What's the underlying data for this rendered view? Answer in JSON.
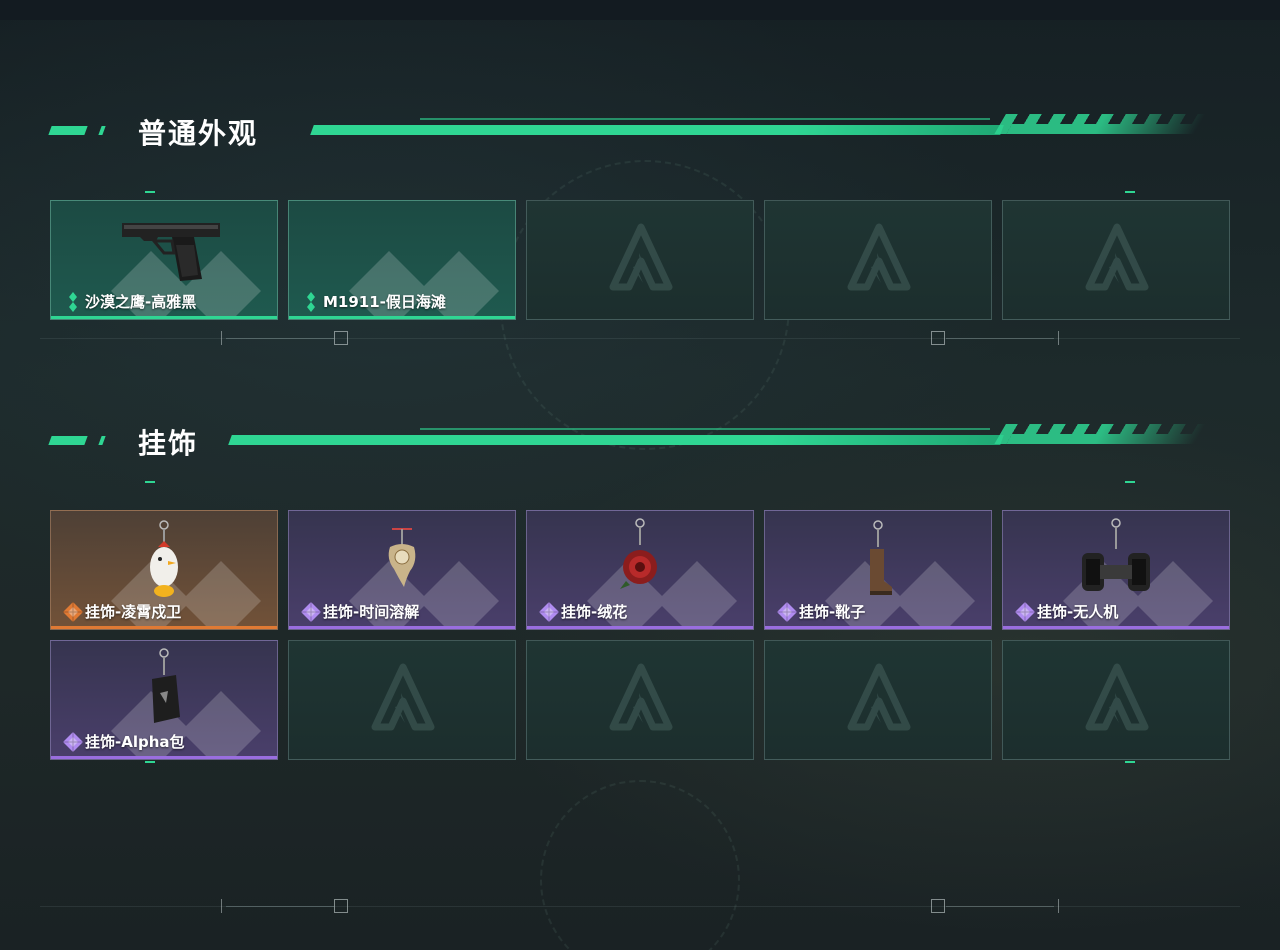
{
  "sections": [
    {
      "title": "普通外观",
      "cards": [
        {
          "name": "沙漠之鹰-高雅黑",
          "rarity": "green",
          "item": "pistol-deagle-icon"
        },
        {
          "name": "M1911-假日海滩",
          "rarity": "green",
          "item": ""
        },
        {
          "name": "",
          "rarity": "empty"
        },
        {
          "name": "",
          "rarity": "empty"
        },
        {
          "name": "",
          "rarity": "empty"
        }
      ]
    },
    {
      "title": "挂饰",
      "cards": [
        {
          "name": "挂饰-凌霄戍卫",
          "rarity": "orange",
          "item": "chicken-charm-icon"
        },
        {
          "name": "挂饰-时间溶解",
          "rarity": "purple",
          "item": "melting-clock-charm-icon"
        },
        {
          "name": "挂饰-绒花",
          "rarity": "purple",
          "item": "rose-charm-icon"
        },
        {
          "name": "挂饰-靴子",
          "rarity": "purple",
          "item": "boot-charm-icon"
        },
        {
          "name": "挂饰-无人机",
          "rarity": "purple",
          "item": "drone-charm-icon"
        },
        {
          "name": "挂饰-Alpha包",
          "rarity": "purple",
          "item": "alpha-bag-charm-icon"
        },
        {
          "name": "",
          "rarity": "empty"
        },
        {
          "name": "",
          "rarity": "empty"
        },
        {
          "name": "",
          "rarity": "empty"
        },
        {
          "name": "",
          "rarity": "empty"
        }
      ]
    }
  ],
  "colors": {
    "accent": "#2fd693",
    "rarity_green": "#2fd693",
    "rarity_orange": "#e07a34",
    "rarity_purple": "#9a6ee0"
  }
}
